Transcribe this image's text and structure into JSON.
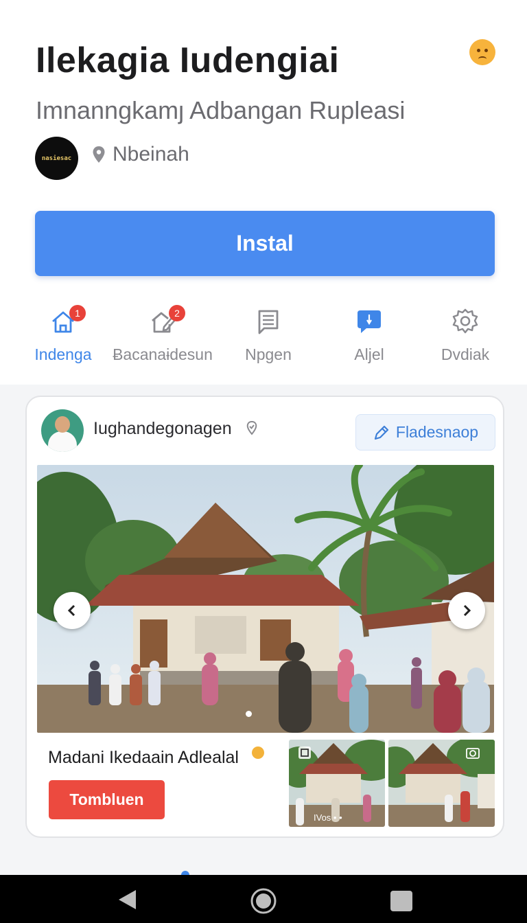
{
  "app": {
    "title": "Ilekagia Iudengiai",
    "subtitle": "Imnanngkamȷ Adbangan Rupleasi",
    "logo_text": "nasiesac",
    "location": "Nbeinah",
    "emoji_icon": "worried-face-icon",
    "install_label": "Instal",
    "accent_color": "#4a8bf0"
  },
  "nav": {
    "items": [
      {
        "label": "Indenga",
        "icon": "home-icon",
        "badge": "1",
        "active": true
      },
      {
        "label": "Ƀacanaɨdesun",
        "icon": "edit-home-icon",
        "badge": "2",
        "active": false
      },
      {
        "label": "Npgen",
        "icon": "document-icon",
        "badge": "",
        "active": false
      },
      {
        "label": "Aljel",
        "icon": "chat-bubble-icon",
        "badge": "",
        "active": false
      },
      {
        "label": "Dvdiak",
        "icon": "gear-icon",
        "badge": "",
        "active": false
      }
    ]
  },
  "post": {
    "author": "Iughandegonagen",
    "follow_label": "Fladesnaop",
    "caption": "Madani Ikedaain Adlealal",
    "action_label": "Tombluen",
    "thumb_label": "IVos • •"
  },
  "system": {
    "back_icon": "back-triangle-icon",
    "home_icon": "home-circle-icon",
    "recents_icon": "recents-square-icon"
  }
}
